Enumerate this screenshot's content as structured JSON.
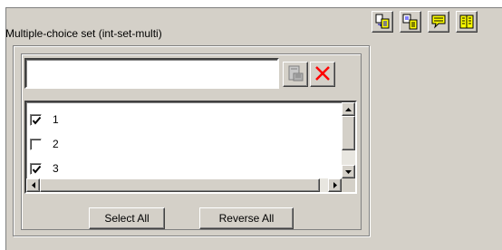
{
  "panel": {
    "title": "Multiple-choice set (int-set-multi)"
  },
  "toolbar": {
    "buttons": [
      {
        "icon": "copy-document-icon"
      },
      {
        "icon": "paste-document-icon"
      },
      {
        "icon": "speech-bubble-icon"
      },
      {
        "icon": "book-icon"
      }
    ]
  },
  "input": {
    "value": "",
    "placeholder": ""
  },
  "input_actions": {
    "list_icon": "list-form-icon",
    "clear_icon": "red-x-icon"
  },
  "list": {
    "items": [
      {
        "label": "1",
        "checked": true
      },
      {
        "label": "2",
        "checked": false
      },
      {
        "label": "3",
        "checked": true
      }
    ]
  },
  "buttons": {
    "select_all": "Select All",
    "reverse_all": "Reverse All"
  },
  "colors": {
    "face": "#d4d0c8",
    "clear_red": "#ff0000",
    "icon_yellow": "#ffff00"
  }
}
